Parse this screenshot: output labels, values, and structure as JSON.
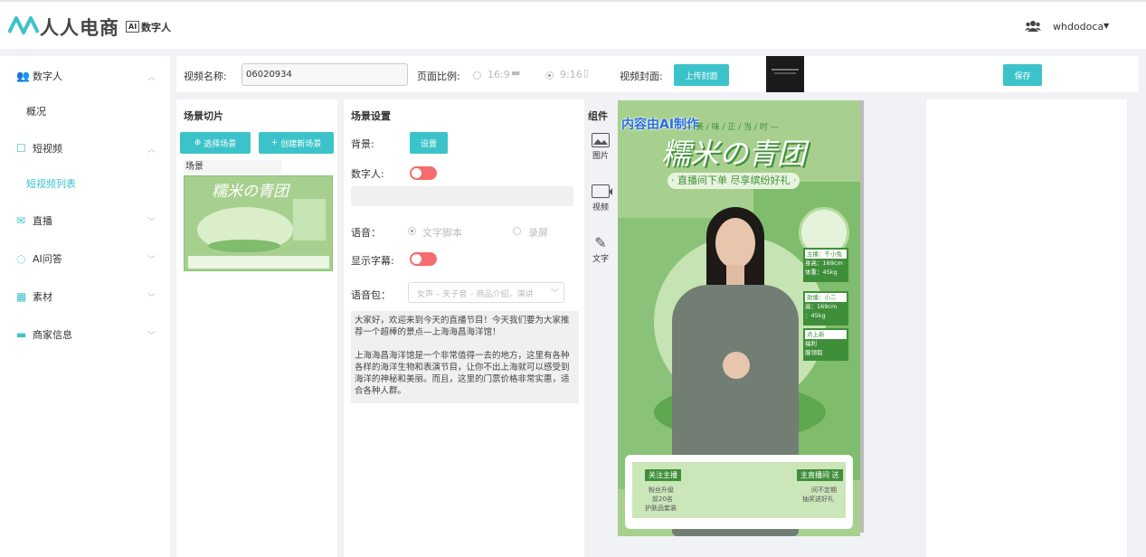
{
  "header": {
    "logo_text": "人人电商",
    "ai_badge": "AI",
    "product_name": "数字人",
    "username": "whdodoca"
  },
  "sidebar": {
    "items": [
      {
        "label": "数字人",
        "icon": "users-icon",
        "expanded": true
      },
      {
        "label": "概况"
      },
      {
        "label": "短视频",
        "icon": "video-square-icon",
        "expanded": true
      },
      {
        "label": "短视频列表",
        "active": true
      },
      {
        "label": "直播",
        "icon": "mail-icon"
      },
      {
        "label": "AI问答",
        "icon": "chat-icon"
      },
      {
        "label": "素材",
        "icon": "grid-icon"
      },
      {
        "label": "商家信息",
        "icon": "store-icon"
      }
    ]
  },
  "toolbar": {
    "name_label": "视频名称:",
    "name_value": "06020934",
    "ratio_label": "页面比例:",
    "ratio_16_9": "16:9",
    "ratio_9_16": "9:16",
    "ratio_selected": "9:16",
    "cover_label": "视频封面:",
    "upload_label": "上传封面",
    "save_label": "保存"
  },
  "scenes": {
    "title": "场景切片",
    "select_label": "选择场景",
    "create_label": "创建新场景",
    "item_label": "场景",
    "thumb_title": "糯米の青团"
  },
  "settings": {
    "title": "场景设置",
    "bg_label": "背景:",
    "bg_button": "设置",
    "avatar_label": "数字人:",
    "voice_label": "语音：",
    "voice_opt1": "文字脚本",
    "voice_opt2": "录屏",
    "subtitle_label": "显示字幕:",
    "package_label": "语音包：",
    "package_value": "女声 – 夹子音 – 商品介绍，演讲",
    "script_p1": "大家好，欢迎来到今天的直播节目！今天我们要为大家推荐一个超棒的景点—上海海昌海洋馆！",
    "script_p2": "上海海昌海洋馆是一个非常值得一去的地方，这里有各种各样的海洋生物和表演节目，让你不出上海就可以感受到海洋的神秘和美丽。而且，这里的门票价格非常实惠，适合各种人群。"
  },
  "components": {
    "title": "组件",
    "items": [
      {
        "label": "图片",
        "icon": "image-icon"
      },
      {
        "label": "视频",
        "icon": "video-icon"
      },
      {
        "label": "文字",
        "icon": "text-icon"
      }
    ]
  },
  "preview": {
    "watermark": "内容由AI制作",
    "tagline": "— 美 / 味 / 正 / 当 / 时 —",
    "title": "糯米の青团",
    "subtitle": "· 直播间下单 尽享缤纷好礼 ·",
    "host_tag": "主播：千小兔",
    "host_height": "身高：169cm",
    "host_weight": "体重：45kg",
    "assistant_tag": "助播：小二",
    "assistant_height": "高：169cm",
    "assistant_weight": "：45kg",
    "new_tag": "点上新",
    "benefit1": "福利",
    "benefit2": "服领取",
    "follow_tag": "关注主播",
    "live_tag": "主直播间 送",
    "fans_text1": "粉丝升级",
    "fans_text2": "前20名",
    "fans_text3": "护肤品套装",
    "gift_text1": "间不定期",
    "gift_text2": "抽奖送好礼",
    "colors": {
      "bg": "#a7d08f",
      "dark": "#3f8f3a",
      "accent": "#f5bf3b"
    }
  }
}
